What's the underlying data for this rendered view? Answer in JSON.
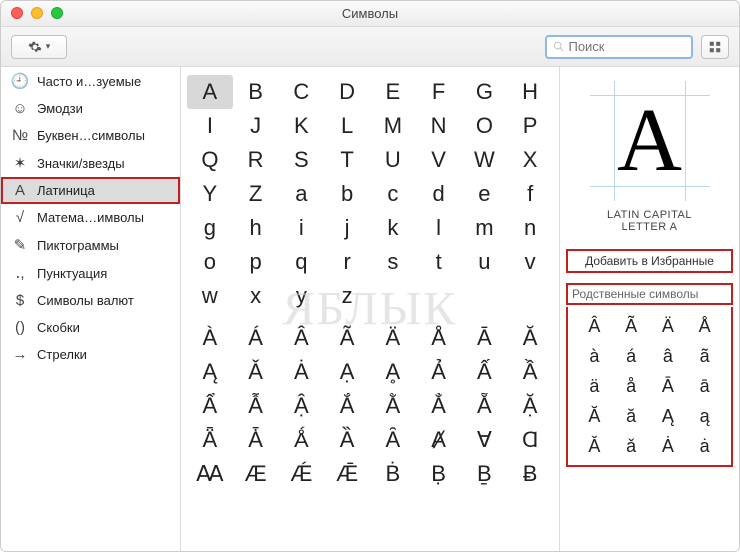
{
  "window": {
    "title": "Символы"
  },
  "search": {
    "placeholder": "Поиск"
  },
  "sidebar": {
    "items": [
      {
        "icon": "🕘",
        "label": "Часто и…зуемые"
      },
      {
        "icon": "☺",
        "label": "Эмодзи"
      },
      {
        "icon": "№",
        "label": "Буквен…символы"
      },
      {
        "icon": "✶",
        "label": "Значки/звезды"
      },
      {
        "icon": "A",
        "label": "Латиница",
        "selected": true
      },
      {
        "icon": "√",
        "label": "Матема…имволы"
      },
      {
        "icon": "✎",
        "label": "Пиктограммы"
      },
      {
        "icon": "․,",
        "label": "Пунктуация"
      },
      {
        "icon": "$",
        "label": "Символы валют"
      },
      {
        "icon": "()",
        "label": "Скобки"
      },
      {
        "icon": "→",
        "label": "Стрелки"
      }
    ]
  },
  "grid": {
    "selected_index": 0,
    "rows_main": [
      [
        "A",
        "B",
        "C",
        "D",
        "E",
        "F",
        "G",
        "H"
      ],
      [
        "I",
        "J",
        "K",
        "L",
        "M",
        "N",
        "O",
        "P"
      ],
      [
        "Q",
        "R",
        "S",
        "T",
        "U",
        "V",
        "W",
        "X"
      ],
      [
        "Y",
        "Z",
        "a",
        "b",
        "c",
        "d",
        "e",
        "f"
      ],
      [
        "g",
        "h",
        "i",
        "j",
        "k",
        "l",
        "m",
        "n"
      ],
      [
        "o",
        "p",
        "q",
        "r",
        "s",
        "t",
        "u",
        "v"
      ],
      [
        "w",
        "x",
        "y",
        "z",
        "",
        "",
        "",
        ""
      ]
    ],
    "rows_ext": [
      [
        "À",
        "Á",
        "Â",
        "Ã",
        "Ä",
        "Å",
        "Ā",
        "Ă"
      ],
      [
        "Ą",
        "Ǎ",
        "Ȧ",
        "Ạ",
        "Ḁ",
        "Ả",
        "Ấ",
        "Ầ"
      ],
      [
        "Ẩ",
        "Ẫ",
        "Ậ",
        "Ắ",
        "Ằ",
        "Ẳ",
        "Ẵ",
        "Ặ"
      ],
      [
        "Ǟ",
        "Ǡ",
        "Ǻ",
        "Ȁ",
        "Ȃ",
        "Ⱥ",
        "Ɐ",
        "Ɑ"
      ],
      [
        "Ꜳ",
        "Æ",
        "Ǽ",
        "Ǣ",
        "Ḃ",
        "Ḅ",
        "Ḇ",
        "Ƀ"
      ]
    ]
  },
  "detail": {
    "glyph": "A",
    "name_line1": "LATIN CAPITAL",
    "name_line2": "LETTER A",
    "favorite_label": "Добавить в Избранные",
    "related_header": "Родственные символы",
    "related": [
      "Â",
      "Ã",
      "Ä",
      "Å",
      "à",
      "á",
      "â",
      "ã",
      "ä",
      "å",
      "Ā",
      "ā",
      "Ă",
      "ă",
      "Ą",
      "ą",
      "Ǎ",
      "ǎ",
      "Ȧ",
      "ȧ"
    ]
  },
  "watermark": "ЯБЛЫК"
}
